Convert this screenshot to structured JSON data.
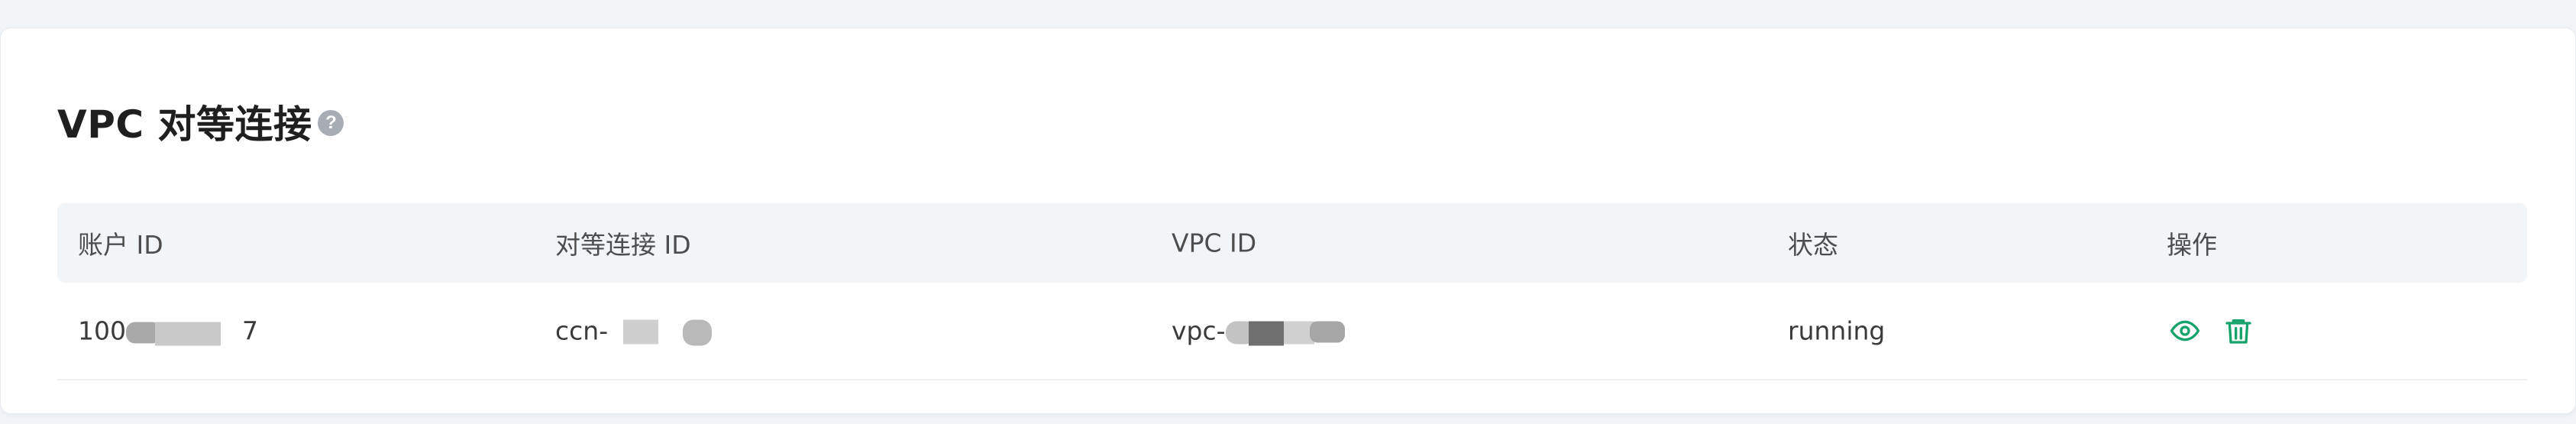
{
  "section": {
    "title": "VPC 对等连接",
    "help_icon": "question-circle-icon",
    "help_glyph": "?"
  },
  "table": {
    "headers": [
      "账户 ID",
      "对等连接 ID",
      "VPC ID",
      "状态",
      "操作"
    ],
    "rows": [
      {
        "account_id_prefix": "100",
        "account_id_suffix": "7",
        "peering_id_prefix": "ccn-",
        "vpc_id_prefix": "vpc-",
        "status": "running"
      }
    ]
  },
  "actions": {
    "view_icon": "eye-icon",
    "delete_icon": "trash-icon",
    "color": "#16a36b"
  },
  "colors": {
    "accent": "#16a36b",
    "header_bg": "#f2f5f8",
    "page_bg": "#f2f5f8"
  }
}
